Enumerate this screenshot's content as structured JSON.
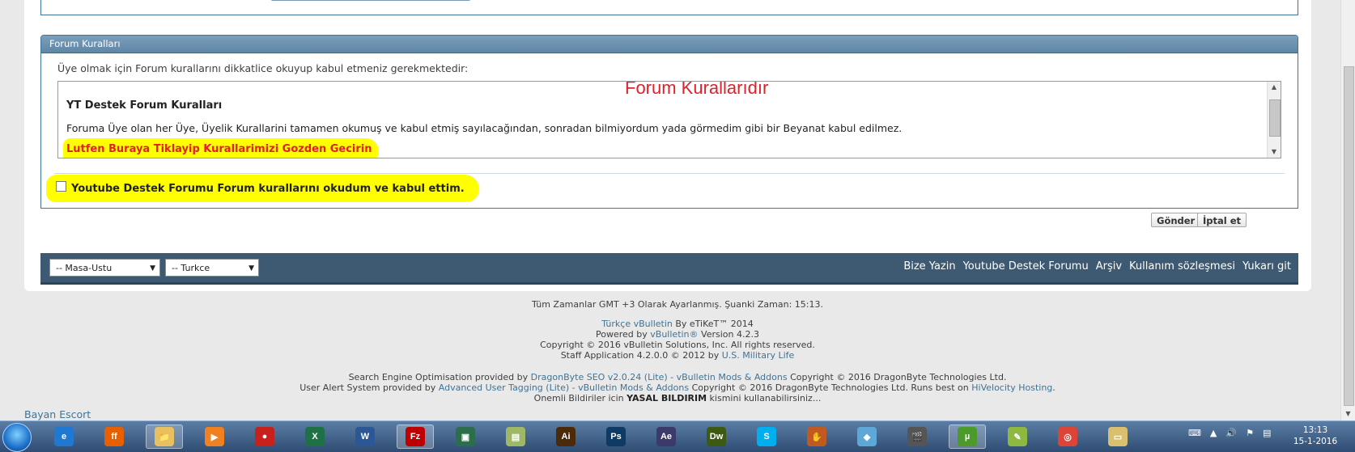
{
  "rules": {
    "header": "Forum Kuralları",
    "intro": "Üye olmak için Forum kurallarını dikkatlice okuyup kabul etmeniz gerekmektedir:",
    "watermark": "Forum Kurallarıdır",
    "box_title": "YT Destek Forum Kuralları",
    "box_text": "Foruma Üye olan her Üye, Üyelik Kurallarini tamamen okumuş ve kabul etmiş sayılacağından, sonradan bilmiyordum yada görmedim gibi bir Beyanat kabul edilmez.",
    "box_link": "Lutfen Buraya Tiklayip Kurallarimizi Gozden Gecirin",
    "accept_label": "Youtube Destek Forumu Forum kurallarını okudum ve kabul ettim."
  },
  "buttons": {
    "submit": "Gönder",
    "cancel": "İptal et"
  },
  "footer": {
    "style_select": "-- Masa-Ustu",
    "language_select": "-- Turkce",
    "links": [
      "Bize Yazin",
      "Youtube Destek Forumu",
      "Arşiv",
      "Kullanım sözleşmesi",
      "Yukarı git"
    ]
  },
  "info": {
    "time": "Tüm Zamanlar GMT +3 Olarak Ayarlanmış. Şuanki Zaman: 15:13.",
    "tr_link": "Türkçe vBulletin",
    "tr_rest": " By eTiKeT™ 2014",
    "powered_pre": "Powered by ",
    "powered_link": "vBulletin®",
    "powered_post": " Version 4.2.3",
    "copyright": "Copyright © 2016 vBulletin Solutions, Inc. All rights reserved.",
    "staff_pre": "Staff Application 4.2.0.0 © 2012 by ",
    "staff_link": "U.S. Military Life",
    "seo_pre": "Search Engine Optimisation provided by ",
    "seo_link": "DragonByte SEO v2.0.24 (Lite) - vBulletin Mods & Addons",
    "seo_post": " Copyright © 2016 DragonByte Technologies Ltd.",
    "alert_pre": "User Alert System provided by ",
    "alert_link": "Advanced User Tagging (Lite) - vBulletin Mods & Addons",
    "alert_mid": " Copyright © 2016 DragonByte Technologies Ltd. Runs best on ",
    "alert_link2": "HiVelocity Hosting",
    "alert_end": ".",
    "notice_pre": "Onemli Bildiriler icin ",
    "notice_bold": "YASAL BILDIRIM",
    "notice_post": " kismini kullanabilirsiniz..."
  },
  "escort_link": "Bayan Escort",
  "taskbar": {
    "clock_time": "13:13",
    "clock_date": "15-1-2016",
    "apps": [
      {
        "name": "ie-icon",
        "label": "e",
        "color": "#1f78d1"
      },
      {
        "name": "firefox-icon",
        "label": "ff",
        "color": "#e66000"
      },
      {
        "name": "explorer-icon",
        "label": "📁",
        "color": "#e8c060"
      },
      {
        "name": "media-player-icon",
        "label": "▶",
        "color": "#f08020"
      },
      {
        "name": "cleaner-icon",
        "label": "●",
        "color": "#c8201c"
      },
      {
        "name": "excel-icon",
        "label": "X",
        "color": "#1e7145"
      },
      {
        "name": "word-icon",
        "label": "W",
        "color": "#2b5797"
      },
      {
        "name": "filezilla-icon",
        "label": "Fz",
        "color": "#bf0000"
      },
      {
        "name": "screen-icon",
        "label": "▣",
        "color": "#2c6e49"
      },
      {
        "name": "notes-icon",
        "label": "▤",
        "color": "#9fb868"
      },
      {
        "name": "illustrator-icon",
        "label": "Ai",
        "color": "#4a2a08"
      },
      {
        "name": "photoshop-icon",
        "label": "Ps",
        "color": "#0e3b64"
      },
      {
        "name": "aftereffects-icon",
        "label": "Ae",
        "color": "#3b3a6a"
      },
      {
        "name": "dreamweaver-icon",
        "label": "Dw",
        "color": "#3c5a12"
      },
      {
        "name": "skype-icon",
        "label": "S",
        "color": "#00aff0"
      },
      {
        "name": "glove-icon",
        "label": "✋",
        "color": "#c05a20"
      },
      {
        "name": "shark-icon",
        "label": "◆",
        "color": "#5ea8d8"
      },
      {
        "name": "clapper-icon",
        "label": "🎬",
        "color": "#555555"
      },
      {
        "name": "utorrent-icon",
        "label": "µ",
        "color": "#4c9a2a"
      },
      {
        "name": "notepad-icon",
        "label": "✎",
        "color": "#8fb840"
      },
      {
        "name": "chrome-icon",
        "label": "◎",
        "color": "#db4437"
      },
      {
        "name": "folder-icon",
        "label": "▭",
        "color": "#d8c070"
      }
    ]
  }
}
